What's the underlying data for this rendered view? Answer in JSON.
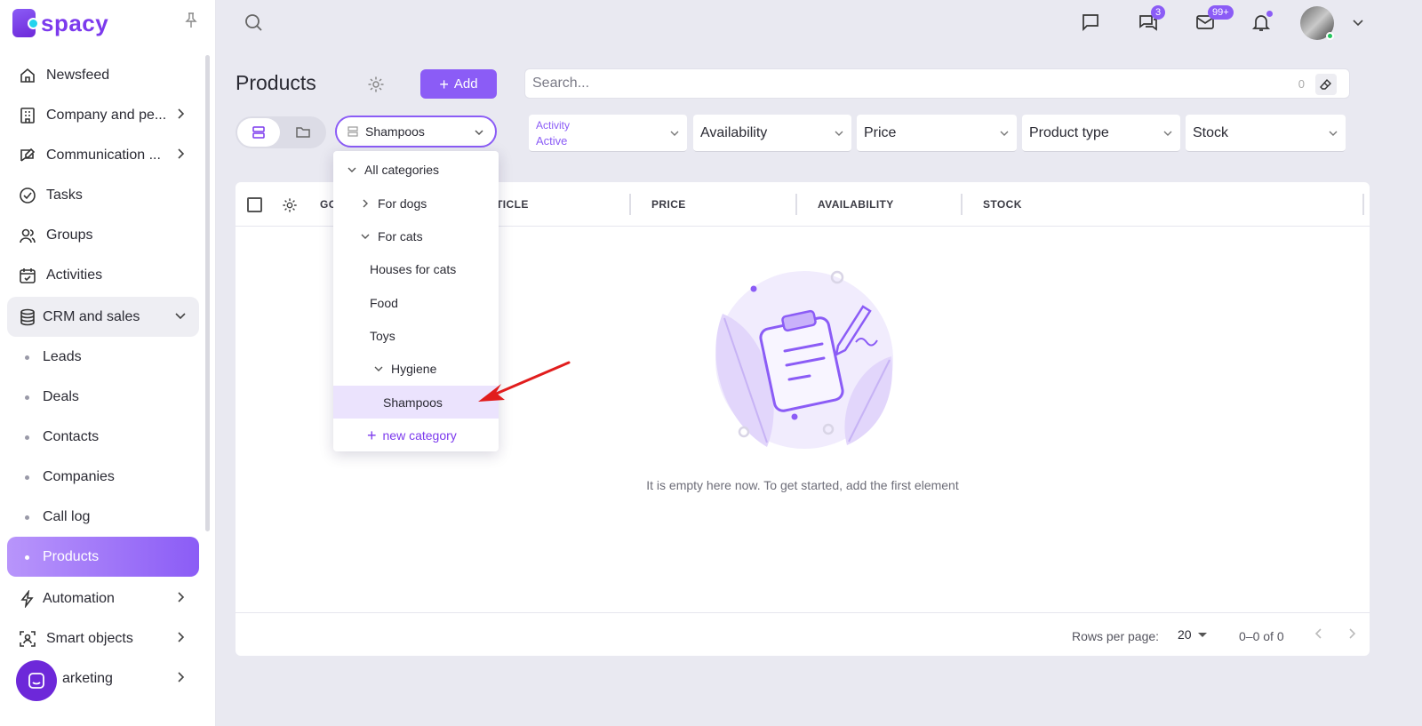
{
  "brand": {
    "logo_text": "spacy"
  },
  "sidebar": {
    "items": [
      {
        "label": "Newsfeed",
        "icon": "home-icon",
        "has_chevron": false
      },
      {
        "label": "Company and pe...",
        "icon": "building-icon",
        "has_chevron": true
      },
      {
        "label": "Communication ...",
        "icon": "chat-pen-icon",
        "has_chevron": true
      },
      {
        "label": "Tasks",
        "icon": "check-circle-icon",
        "has_chevron": false
      },
      {
        "label": "Groups",
        "icon": "users-icon",
        "has_chevron": false
      },
      {
        "label": "Activities",
        "icon": "calendar-icon",
        "has_chevron": false
      },
      {
        "label": "CRM and sales",
        "icon": "database-icon",
        "has_chevron": true,
        "expanded": true
      }
    ],
    "crm_children": [
      "Leads",
      "Deals",
      "Contacts",
      "Companies",
      "Call log",
      "Products"
    ],
    "active_child": "Products",
    "after_items": [
      {
        "label": "Automation",
        "icon": "lightning-icon"
      },
      {
        "label": "Smart objects",
        "icon": "scan-icon"
      },
      {
        "label": "arketing",
        "icon": "megaphone-icon"
      }
    ]
  },
  "topbar": {
    "chat_badge": "3",
    "mail_badge": "99+"
  },
  "page": {
    "title": "Products",
    "add_label": "Add",
    "search_placeholder": "Search...",
    "search_count": "0",
    "category_value": "Shampoos"
  },
  "filters": {
    "activity_label": "Activity",
    "activity_value": "Active",
    "availability": "Availability",
    "price": "Price",
    "product_type": "Product type",
    "stock": "Stock"
  },
  "table": {
    "columns": [
      "GO",
      "RTICLE",
      "PRICE",
      "AVAILABILITY",
      "STOCK"
    ],
    "empty_message": "It is empty here now. To get started, add the first element",
    "rows_per_page_label": "Rows per page:",
    "rows_per_page": "20",
    "range": "0–0 of 0"
  },
  "dropdown": {
    "items": [
      {
        "label": "All categories",
        "chevron": "down"
      },
      {
        "label": "For dogs",
        "chevron": "right"
      },
      {
        "label": "For cats",
        "chevron": "down"
      },
      {
        "label": "Houses for cats",
        "chevron": "none"
      },
      {
        "label": "Food",
        "chevron": "none"
      },
      {
        "label": "Toys",
        "chevron": "none"
      },
      {
        "label": "Hygiene",
        "chevron": "down"
      },
      {
        "label": "Shampoos",
        "chevron": "none",
        "selected": true
      }
    ],
    "new_category_label": "new category"
  },
  "colors": {
    "accent": "#8b5cf6",
    "annotation_arrow": "#e11d1d"
  }
}
